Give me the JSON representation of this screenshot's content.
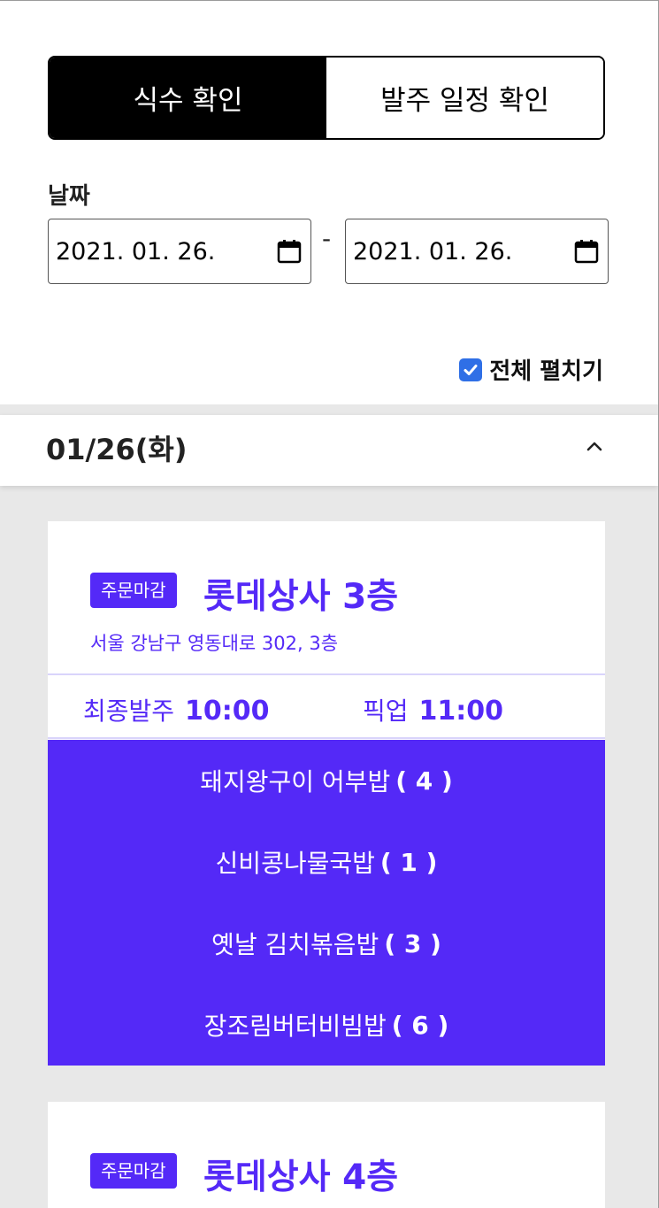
{
  "tabs": [
    {
      "label": "식수 확인",
      "active": true
    },
    {
      "label": "발주 일정 확인",
      "active": false
    }
  ],
  "date_filter": {
    "label": "날짜",
    "start": "2021. 01. 26.",
    "separator": "-",
    "end": "2021. 01. 26."
  },
  "expand_all": {
    "label": "전체 펼치기",
    "checked": true
  },
  "day_group": {
    "title": "01/26(화)",
    "expanded": true
  },
  "stores": [
    {
      "badge": "주문마감",
      "name": "롯데상사 3층",
      "address": "서울 강남구 영동대로 302, 3층",
      "final_order_label": "최종발주",
      "final_order_time": "10:00",
      "pickup_label": "픽업",
      "pickup_time": "11:00",
      "menus": [
        {
          "name": "돼지왕구이 어부밥",
          "count": "( 4 )"
        },
        {
          "name": "신비콩나물국밥",
          "count": "( 1 )"
        },
        {
          "name": "옛날 김치볶음밥",
          "count": "( 3 )"
        },
        {
          "name": "장조림버터비빔밥",
          "count": "( 6 )"
        }
      ]
    },
    {
      "badge": "주문마감",
      "name": "롯데상사 4층"
    }
  ],
  "colors": {
    "accent": "#5429f7",
    "tab_active_bg": "#000000",
    "checkbox": "#2f6fe6",
    "section_bg": "#e8e8e8"
  },
  "icons": {
    "calendar": "calendar-icon",
    "chevron": "chevron-up-icon",
    "check": "check-icon"
  }
}
